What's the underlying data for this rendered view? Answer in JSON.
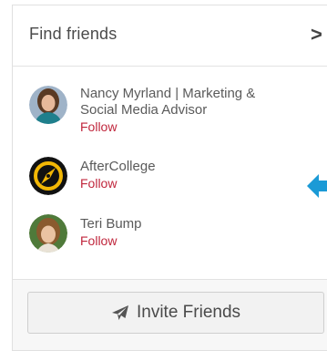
{
  "header": {
    "title": "Find friends",
    "chevron_glyph": ">"
  },
  "friends": [
    {
      "name_line1": "Nancy Myrland | Marketing &",
      "name_line2": "Social Media Advisor",
      "follow_label": "Follow",
      "avatar": "person-avatar"
    },
    {
      "name_line1": "AfterCollege",
      "follow_label": "Follow",
      "avatar": "compass-logo-avatar"
    },
    {
      "name_line1": "Teri Bump",
      "follow_label": "Follow",
      "avatar": "person-avatar"
    }
  ],
  "invite_button": {
    "label": "Invite Friends",
    "icon": "paper-plane-icon"
  },
  "colors": {
    "follow": "#c0263c",
    "arrow": "#1b9ad6",
    "text": "#5a5a5a"
  }
}
